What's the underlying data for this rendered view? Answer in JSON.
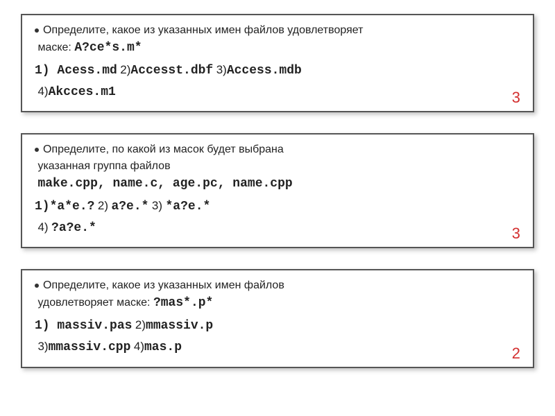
{
  "box1": {
    "q1": "Определите, какое из указанных имен файлов удовлетворяет",
    "q2_prefix": "маске: ",
    "mask": "A?ce*s.m*",
    "o1n": "1) ",
    "o1v": "Acess.md",
    "o2n": "  2)",
    "o2v": "Accesst.dbf",
    "o3n": "  3)",
    "o3v": "Access.mdb",
    "o4n": "4)",
    "o4v": "Akcces.m1",
    "answer": "3"
  },
  "box2": {
    "q1": "Определите, по какой из масок будет выбрана",
    "q2": "указанная группа файлов",
    "files": "make.cpp, name.c, age.pc, name.cpp",
    "o1n": "1)",
    "o1v": "*a*e.?",
    "o2n": "   2)",
    "o2v": "a?e.*",
    "o3n": "  3)",
    "o3v": "*a?e.*",
    "o4n": "4)",
    "o4v": "?a?e.*",
    "answer": "3"
  },
  "box3": {
    "q1": "Определите, какое из указанных имен файлов",
    "q2_prefix": "удовлетворяет маске: ",
    "mask": "?mas*.p*",
    "o1n": "1) ",
    "o1v": "massiv.pas",
    "o2n": " 2)",
    "o2v": "mmassiv.p",
    "o3n": "3)",
    "o3v": "mmassiv.cpp",
    "o4n": "  4)",
    "o4v": "mas.p",
    "answer": "2"
  }
}
